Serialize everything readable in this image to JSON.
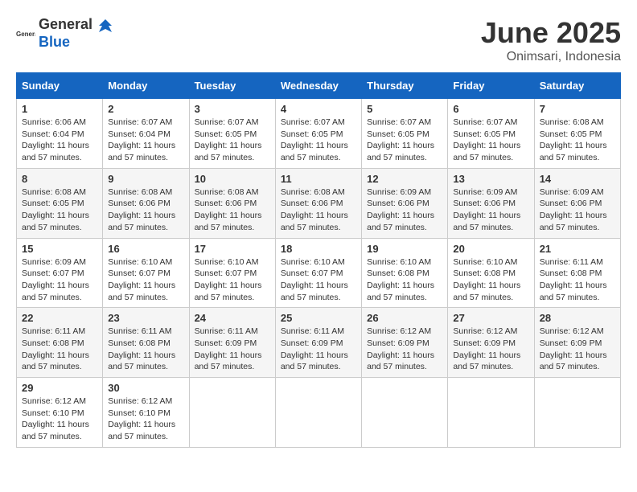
{
  "header": {
    "logo_general": "General",
    "logo_blue": "Blue",
    "month_title": "June 2025",
    "location": "Onimsari, Indonesia"
  },
  "days_of_week": [
    "Sunday",
    "Monday",
    "Tuesday",
    "Wednesday",
    "Thursday",
    "Friday",
    "Saturday"
  ],
  "weeks": [
    [
      {
        "day": "1",
        "sunrise": "6:06 AM",
        "sunset": "6:04 PM",
        "daylight": "11 hours and 57 minutes."
      },
      {
        "day": "2",
        "sunrise": "6:07 AM",
        "sunset": "6:04 PM",
        "daylight": "11 hours and 57 minutes."
      },
      {
        "day": "3",
        "sunrise": "6:07 AM",
        "sunset": "6:05 PM",
        "daylight": "11 hours and 57 minutes."
      },
      {
        "day": "4",
        "sunrise": "6:07 AM",
        "sunset": "6:05 PM",
        "daylight": "11 hours and 57 minutes."
      },
      {
        "day": "5",
        "sunrise": "6:07 AM",
        "sunset": "6:05 PM",
        "daylight": "11 hours and 57 minutes."
      },
      {
        "day": "6",
        "sunrise": "6:07 AM",
        "sunset": "6:05 PM",
        "daylight": "11 hours and 57 minutes."
      },
      {
        "day": "7",
        "sunrise": "6:08 AM",
        "sunset": "6:05 PM",
        "daylight": "11 hours and 57 minutes."
      }
    ],
    [
      {
        "day": "8",
        "sunrise": "6:08 AM",
        "sunset": "6:05 PM",
        "daylight": "11 hours and 57 minutes."
      },
      {
        "day": "9",
        "sunrise": "6:08 AM",
        "sunset": "6:06 PM",
        "daylight": "11 hours and 57 minutes."
      },
      {
        "day": "10",
        "sunrise": "6:08 AM",
        "sunset": "6:06 PM",
        "daylight": "11 hours and 57 minutes."
      },
      {
        "day": "11",
        "sunrise": "6:08 AM",
        "sunset": "6:06 PM",
        "daylight": "11 hours and 57 minutes."
      },
      {
        "day": "12",
        "sunrise": "6:09 AM",
        "sunset": "6:06 PM",
        "daylight": "11 hours and 57 minutes."
      },
      {
        "day": "13",
        "sunrise": "6:09 AM",
        "sunset": "6:06 PM",
        "daylight": "11 hours and 57 minutes."
      },
      {
        "day": "14",
        "sunrise": "6:09 AM",
        "sunset": "6:06 PM",
        "daylight": "11 hours and 57 minutes."
      }
    ],
    [
      {
        "day": "15",
        "sunrise": "6:09 AM",
        "sunset": "6:07 PM",
        "daylight": "11 hours and 57 minutes."
      },
      {
        "day": "16",
        "sunrise": "6:10 AM",
        "sunset": "6:07 PM",
        "daylight": "11 hours and 57 minutes."
      },
      {
        "day": "17",
        "sunrise": "6:10 AM",
        "sunset": "6:07 PM",
        "daylight": "11 hours and 57 minutes."
      },
      {
        "day": "18",
        "sunrise": "6:10 AM",
        "sunset": "6:07 PM",
        "daylight": "11 hours and 57 minutes."
      },
      {
        "day": "19",
        "sunrise": "6:10 AM",
        "sunset": "6:08 PM",
        "daylight": "11 hours and 57 minutes."
      },
      {
        "day": "20",
        "sunrise": "6:10 AM",
        "sunset": "6:08 PM",
        "daylight": "11 hours and 57 minutes."
      },
      {
        "day": "21",
        "sunrise": "6:11 AM",
        "sunset": "6:08 PM",
        "daylight": "11 hours and 57 minutes."
      }
    ],
    [
      {
        "day": "22",
        "sunrise": "6:11 AM",
        "sunset": "6:08 PM",
        "daylight": "11 hours and 57 minutes."
      },
      {
        "day": "23",
        "sunrise": "6:11 AM",
        "sunset": "6:08 PM",
        "daylight": "11 hours and 57 minutes."
      },
      {
        "day": "24",
        "sunrise": "6:11 AM",
        "sunset": "6:09 PM",
        "daylight": "11 hours and 57 minutes."
      },
      {
        "day": "25",
        "sunrise": "6:11 AM",
        "sunset": "6:09 PM",
        "daylight": "11 hours and 57 minutes."
      },
      {
        "day": "26",
        "sunrise": "6:12 AM",
        "sunset": "6:09 PM",
        "daylight": "11 hours and 57 minutes."
      },
      {
        "day": "27",
        "sunrise": "6:12 AM",
        "sunset": "6:09 PM",
        "daylight": "11 hours and 57 minutes."
      },
      {
        "day": "28",
        "sunrise": "6:12 AM",
        "sunset": "6:09 PM",
        "daylight": "11 hours and 57 minutes."
      }
    ],
    [
      {
        "day": "29",
        "sunrise": "6:12 AM",
        "sunset": "6:10 PM",
        "daylight": "11 hours and 57 minutes."
      },
      {
        "day": "30",
        "sunrise": "6:12 AM",
        "sunset": "6:10 PM",
        "daylight": "11 hours and 57 minutes."
      },
      null,
      null,
      null,
      null,
      null
    ]
  ]
}
